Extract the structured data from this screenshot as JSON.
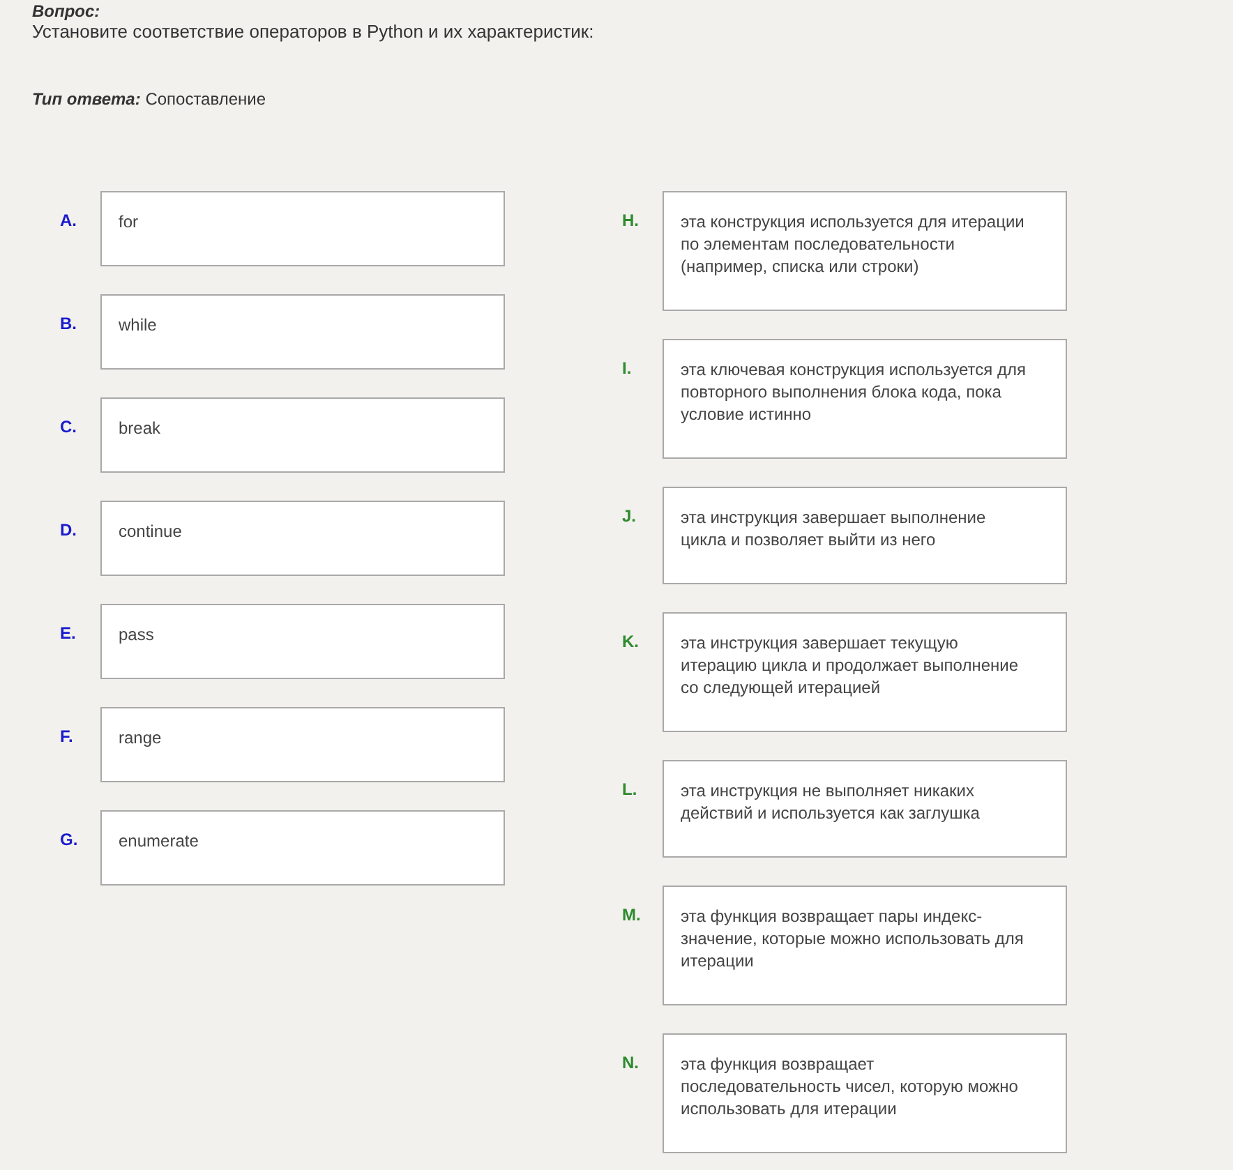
{
  "question_label": "Вопрос:",
  "question": "Установите соответствие операторов в Python и их характеристик:",
  "answer_type": {
    "label": "Тип ответа:",
    "value": "Сопоставление"
  },
  "left_items": [
    {
      "letter": "A.",
      "text": "for"
    },
    {
      "letter": "B.",
      "text": "while"
    },
    {
      "letter": "C.",
      "text": "break"
    },
    {
      "letter": "D.",
      "text": "continue"
    },
    {
      "letter": "E.",
      "text": "pass"
    },
    {
      "letter": "F.",
      "text": "range"
    },
    {
      "letter": "G.",
      "text": "enumerate"
    }
  ],
  "right_items": [
    {
      "letter": "H.",
      "text": "эта конструкция используется для итерации\nпо элементам последовательности\n(например, списка или строки)"
    },
    {
      "letter": "I.",
      "text": "эта ключевая конструкция используется для\nповторного выполнения блока кода, пока\nусловие истинно"
    },
    {
      "letter": "J.",
      "text": "эта инструкция завершает выполнение\nцикла и позволяет выйти из него"
    },
    {
      "letter": "K.",
      "text": "эта инструкция завершает текущую\nитерацию цикла и продолжает выполнение\nсо следующей итерацией"
    },
    {
      "letter": "L.",
      "text": "эта инструкция не выполняет никаких\nдействий и используется как заглушка"
    },
    {
      "letter": "M.",
      "text": "эта функция возвращает пары индекс-\nзначение, которые можно использовать для\nитерации"
    },
    {
      "letter": "N.",
      "text": "эта функция возвращает\nпоследовательность чисел, которую можно\nиспользовать для итерации"
    }
  ]
}
